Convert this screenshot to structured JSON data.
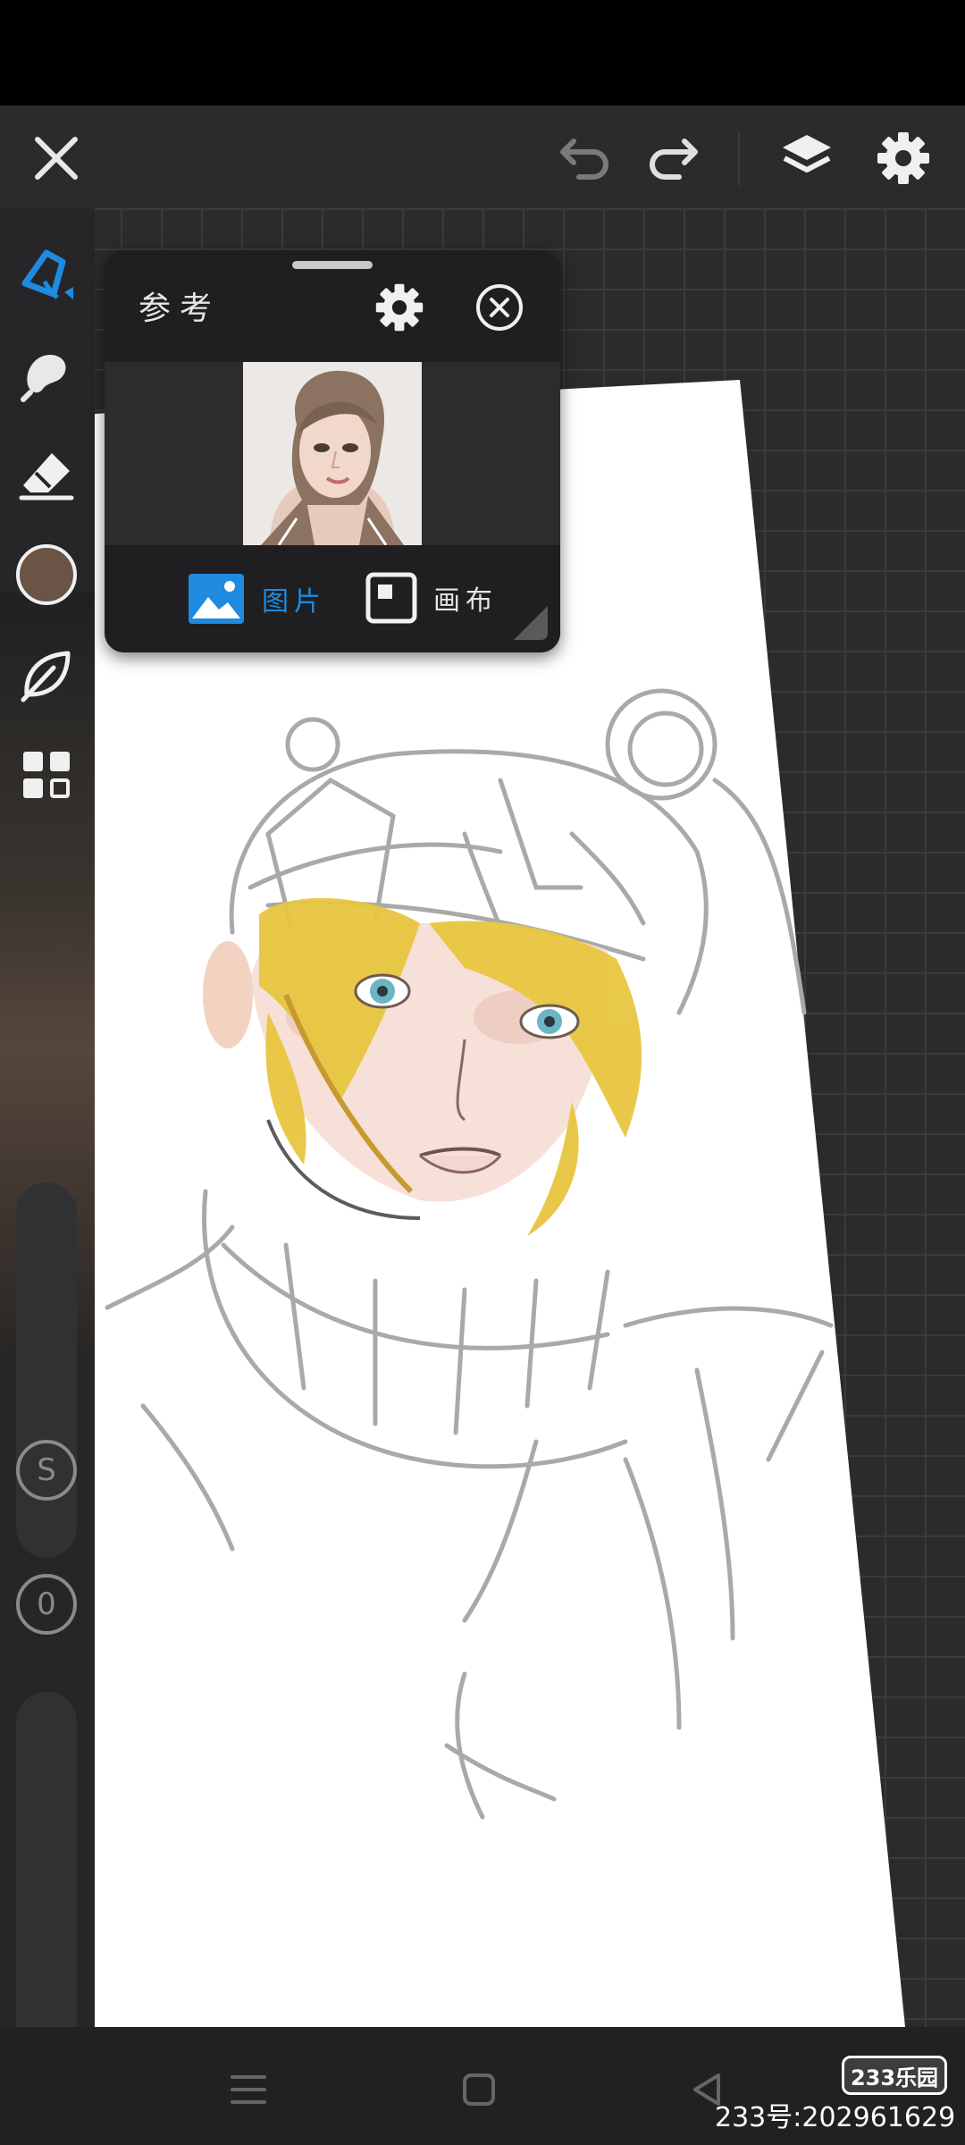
{
  "app": {
    "accent_color": "#1e8be0",
    "brush_color": "#6a5446"
  },
  "toolbar": {
    "close_icon": "close-icon",
    "undo_icon": "undo-icon",
    "redo_icon": "redo-icon",
    "layers_icon": "layers-icon",
    "settings_icon": "gear-icon"
  },
  "tools": [
    {
      "name": "brush",
      "icon": "brush-icon",
      "active": true
    },
    {
      "name": "smudge",
      "icon": "smudge-icon"
    },
    {
      "name": "eraser",
      "icon": "eraser-icon"
    },
    {
      "name": "color",
      "icon": "color-swatch",
      "value": "#6a5446"
    },
    {
      "name": "leaf",
      "icon": "leaf-icon"
    },
    {
      "name": "more",
      "icon": "grid-icon"
    }
  ],
  "sliders": {
    "size_label": "S",
    "opacity_label": "0"
  },
  "reference_panel": {
    "title": "参考",
    "tabs": [
      {
        "label": "图片",
        "active": true
      },
      {
        "label": "画布",
        "active": false
      }
    ]
  },
  "watermark": {
    "logo": "233乐园",
    "id_text": "233号:202961629"
  }
}
